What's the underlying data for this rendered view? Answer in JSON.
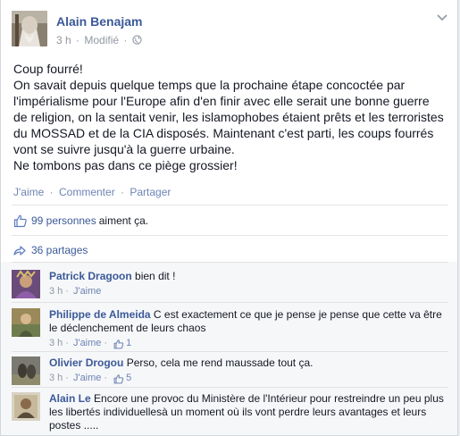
{
  "post": {
    "author": "Alain Benajam",
    "time": "3 h",
    "edited": "Modifié",
    "text": "Coup fourré!\nOn savait depuis quelque temps que la prochaine étape concoctée par l'impérialisme pour l'Europe afin d'en finir avec elle serait une bonne guerre de religion, on la sentait venir, les islamophobes étaient prêts et les terroristes du MOSSAD et de la CIA disposés. Maintenant c'est parti, les coups fourrés vont se suivre jusqu'à la guerre urbaine.\nNe tombons pas dans ce piège grossier!"
  },
  "actions": {
    "like": "J'aime",
    "comment": "Commenter",
    "share": "Partager",
    "sep": "·"
  },
  "likes": {
    "link": "99 personnes",
    "suffix": "aiment ça."
  },
  "shares": {
    "link": "36 partages"
  },
  "comments": [
    {
      "name": "Patrick Dragoon",
      "text": "bien dit !",
      "time": "3 h",
      "like": "J'aime",
      "count": ""
    },
    {
      "name": "Philippe de Almeida",
      "text": "C est exactement ce que je pense je pense que cette va être le déclenchement de leurs chaos",
      "time": "3 h",
      "like": "J'aime",
      "count": "1"
    },
    {
      "name": "Olivier Drogou",
      "text": "Perso, cela me rend maussade tout ça.",
      "time": "3 h",
      "like": "J'aime",
      "count": "5"
    },
    {
      "name": "Alain Le",
      "text": "Encore une provoc du Ministère de l'Intérieur pour restreindre un peu plus les libertés individuellesà un moment où ils vont perdre leurs avantages et leurs postes .....",
      "time": "",
      "like": "",
      "count": ""
    }
  ],
  "colors": {
    "link": "#3b5998",
    "muted": "#9197a3",
    "action": "#6d84b4"
  },
  "icons": [
    "globe-icon",
    "chevron-down-icon",
    "thumbs-up-icon",
    "share-arrow-icon"
  ]
}
